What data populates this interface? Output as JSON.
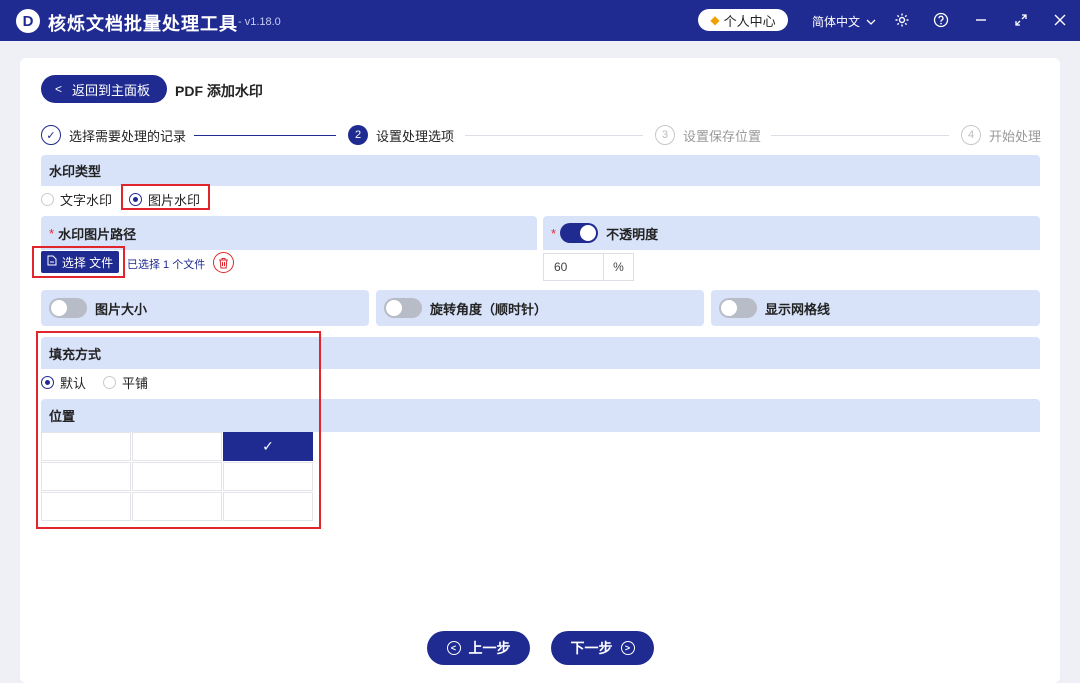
{
  "titlebar": {
    "logo_letter": "D",
    "app_title": "核烁文档批量处理工具",
    "version": "- v1.18.0",
    "user_center": "个人中心",
    "language": "简体中文"
  },
  "header": {
    "back_label": "返回到主面板",
    "page_title": "PDF 添加水印"
  },
  "steps": [
    {
      "num": "✓",
      "label": "选择需要处理的记录",
      "state": "done"
    },
    {
      "num": "2",
      "label": "设置处理选项",
      "state": "active"
    },
    {
      "num": "3",
      "label": "设置保存位置",
      "state": "todo"
    },
    {
      "num": "4",
      "label": "开始处理",
      "state": "todo"
    }
  ],
  "watermark_type": {
    "title": "水印类型",
    "options": [
      "文字水印",
      "图片水印"
    ],
    "selected": "图片水印"
  },
  "image_path": {
    "required_mark": "*",
    "title": "水印图片路径",
    "button_label": "选择 文件",
    "file_count": "已选择 1 个文件"
  },
  "opacity": {
    "required_mark": "*",
    "title": "不透明度",
    "enabled": true,
    "value": "60",
    "unit": "%"
  },
  "toggles": {
    "image_size": "图片大小",
    "rotation": "旋转角度（顺时针）",
    "grid_lines": "显示网格线"
  },
  "fill_mode": {
    "title": "填充方式",
    "options": [
      "默认",
      "平铺"
    ],
    "selected": "默认"
  },
  "position": {
    "title": "位置",
    "check": "✓",
    "selected_cell": 2
  },
  "nav": {
    "prev": "上一步",
    "next": "下一步"
  },
  "colors": {
    "primary": "#1f2b91",
    "section_bg": "#d8e3fa",
    "highlight": "#e0262c"
  }
}
